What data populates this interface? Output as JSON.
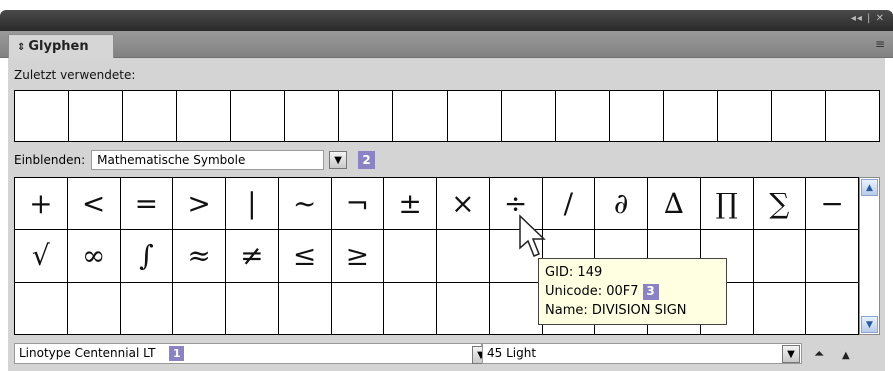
{
  "panel": {
    "window_controls": "◂◂ | ✕",
    "tab_label": "Glyphen",
    "tab_arrows": "⇕",
    "menu_icon": "≡"
  },
  "recent": {
    "label": "Zuletzt verwendete:",
    "cells": [
      "",
      "",
      "",
      "",
      "",
      "",
      "",
      "",
      "",
      "",
      "",
      "",
      "",
      "",
      "",
      ""
    ]
  },
  "show": {
    "label": "Einblenden:",
    "selected": "Mathematische Symbole",
    "badge": "2"
  },
  "glyphs": [
    "+",
    "<",
    "=",
    ">",
    "|",
    "~",
    "¬",
    "±",
    "×",
    "÷",
    "/",
    "∂",
    "∆",
    "∏",
    "∑",
    "−",
    "√",
    "∞",
    "∫",
    "≈",
    "≠",
    "≤",
    "≥",
    "",
    "",
    "",
    "",
    "",
    "",
    "",
    "",
    "",
    "",
    "",
    "",
    "",
    "",
    "",
    "",
    "",
    "",
    "",
    "",
    "",
    "",
    "",
    "",
    ""
  ],
  "tooltip": {
    "gid": "GID: 149",
    "unicode": "Unicode: 00F7",
    "name": "Name: DIVISION SIGN",
    "badge": "3"
  },
  "bottom": {
    "font": "Linotype Centennial LT",
    "font_badge": "1",
    "style": "45 Light"
  },
  "icons": {
    "scroll_up": "▲",
    "scroll_down": "▼",
    "dropdown": "▼",
    "zoom_out": "⏶",
    "zoom_in": "▲"
  }
}
